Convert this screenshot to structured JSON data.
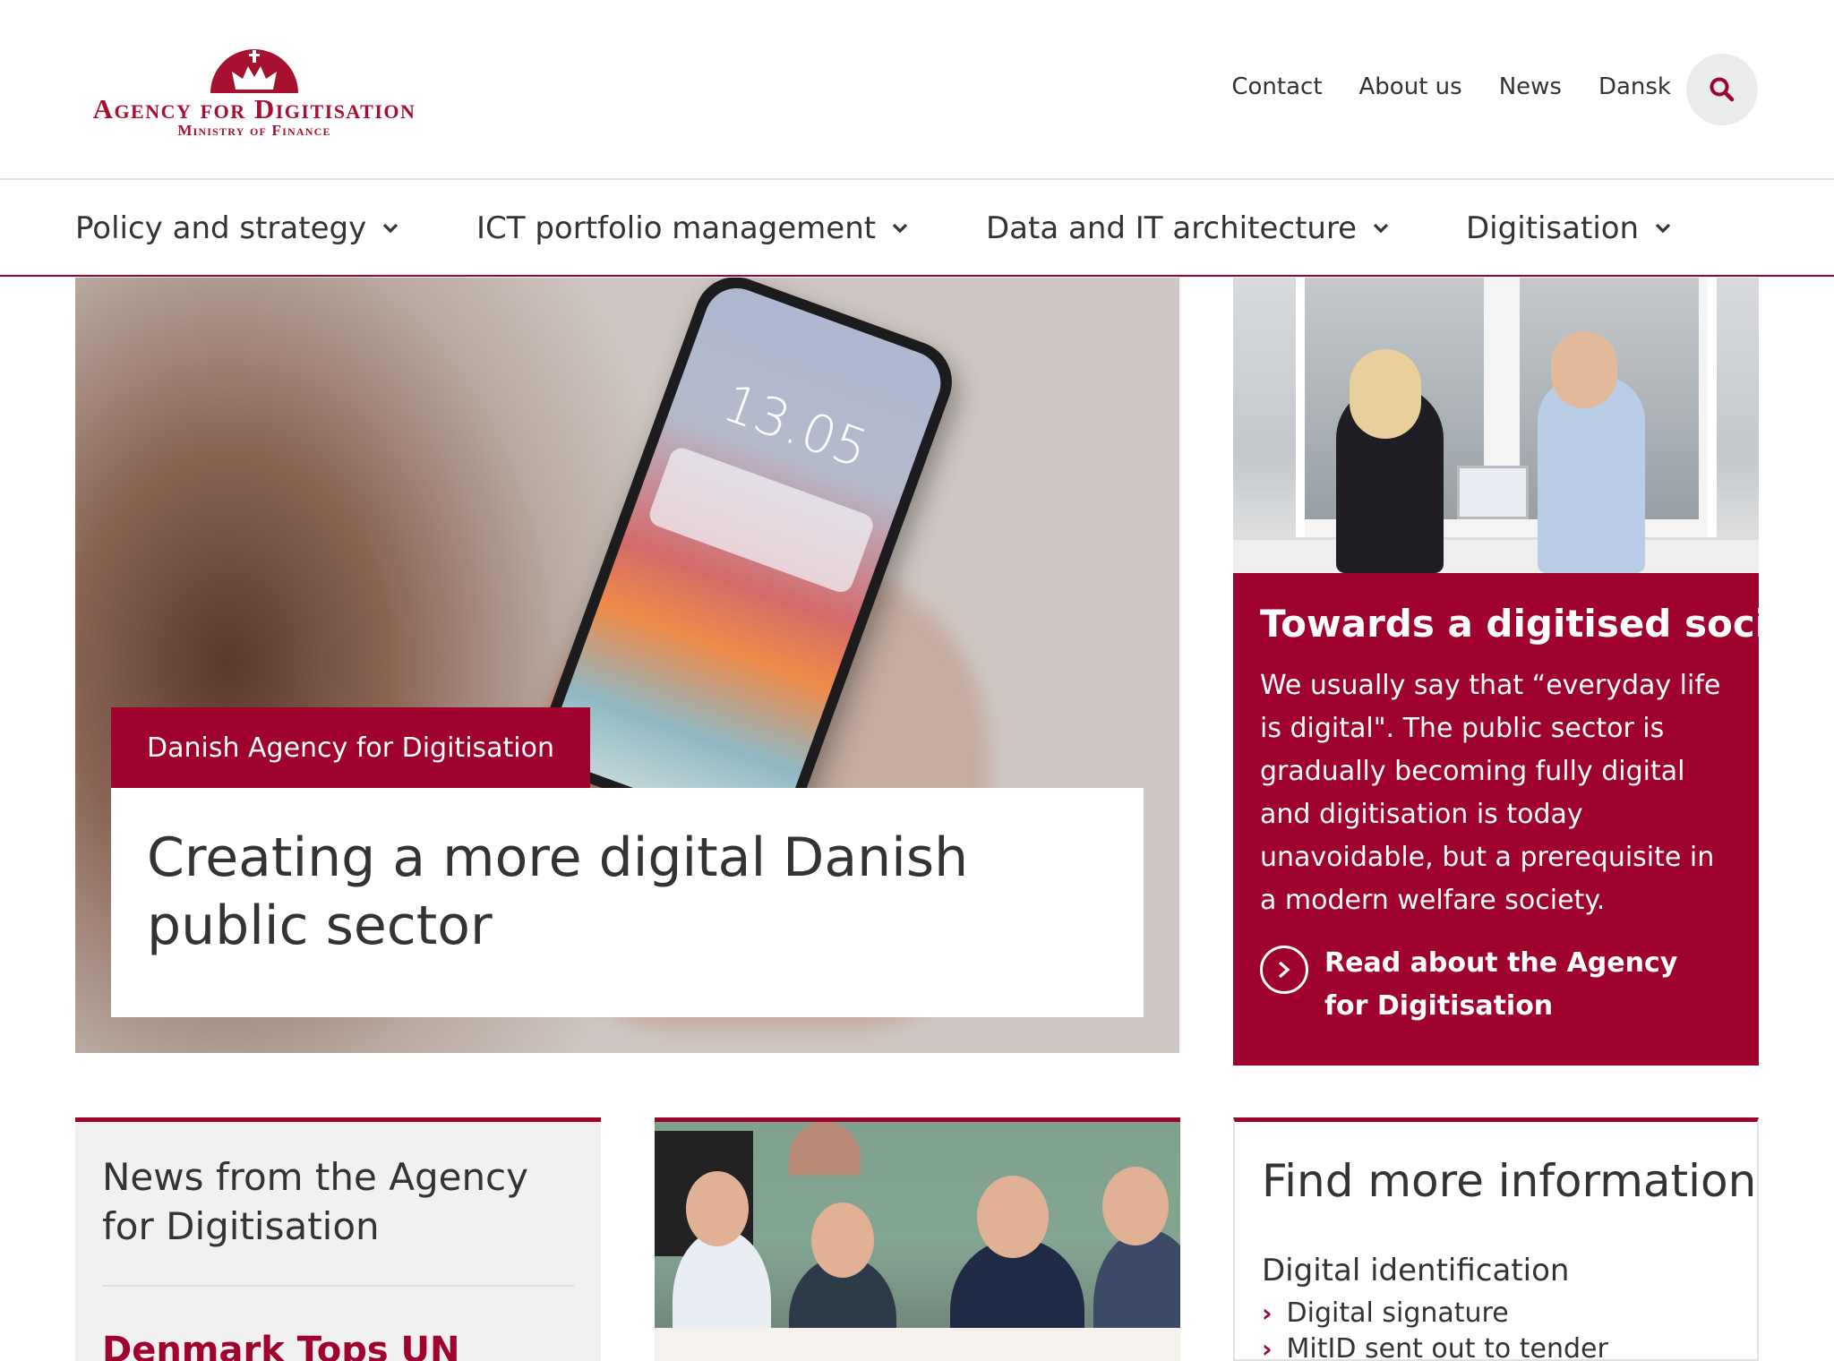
{
  "logo": {
    "title": "Agency for Digitisation",
    "subtitle": "Ministry of Finance"
  },
  "header": {
    "links": [
      "Contact",
      "About us",
      "News",
      "Dansk"
    ],
    "search_icon": "search-icon"
  },
  "nav": [
    {
      "label": "Policy and strategy"
    },
    {
      "label": "ICT portfolio management"
    },
    {
      "label": "Data and IT architecture"
    },
    {
      "label": "Digitisation"
    }
  ],
  "hero": {
    "tag": "Danish Agency for Digitisation",
    "title": "Creating a more digital Danish public sector",
    "phone_time": "13.05"
  },
  "feature": {
    "title": "Towards a digitised society",
    "body": "We usually say that “everyday life is digital\". The public sector is gradually becoming fully digital and digitisation is today unavoidable, but a prerequisite in a modern welfare society.",
    "link": "Read about the Agency for Digitisation"
  },
  "news": {
    "title": "News from the Agency for Digitisation",
    "first_link": "Denmark Tops UN"
  },
  "info": {
    "title": "Find more information",
    "section": "Digital identification",
    "items": [
      "Digital signature",
      "MitID sent out to tender"
    ]
  },
  "colors": {
    "brand": "#a0022e",
    "text": "#333333"
  }
}
